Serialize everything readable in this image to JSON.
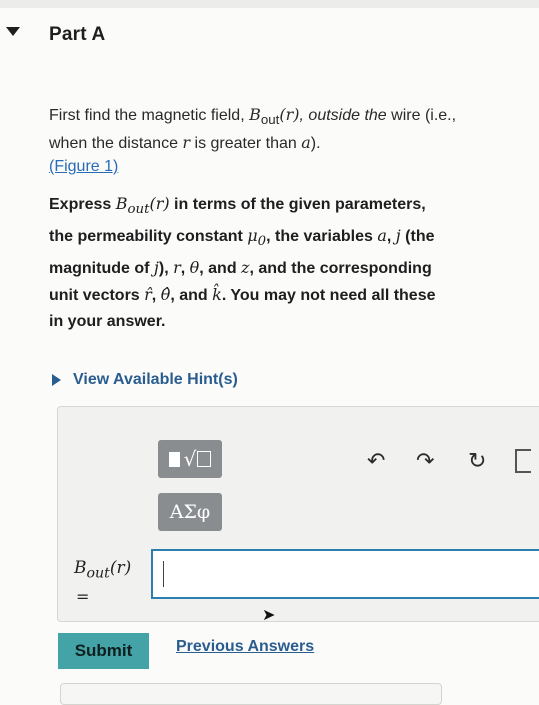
{
  "part": {
    "title": "Part A"
  },
  "instructions": {
    "p1_a": "First find the magnetic field, ",
    "p1_b": "B",
    "p1_c": "out",
    "p1_d": "(r)",
    "p1_e": ", outside the",
    "p1_f": "wire (i.e., when the distance ",
    "p1_g": "r",
    "p1_h": " is greater than ",
    "p1_i": "a",
    "p1_j": ").",
    "figure_link": "(Figure 1)",
    "p2_a": "Express ",
    "p2_b": "B",
    "p2_c": "out",
    "p2_d": "(r)",
    "p2_e": " in terms of the given parameters, the permeability constant ",
    "p2_f": "μ",
    "p2_g": "0",
    "p2_h": ", the variables ",
    "p2_i": "a",
    "p2_j": ", ",
    "p2_k": "j",
    "p2_l": " (the magnitude of ",
    "p2_m": "j",
    "p2_n": "), ",
    "p2_o": "r",
    "p2_p": ", ",
    "p2_q": "θ",
    "p2_r": ", and ",
    "p2_s": "z",
    "p2_t": ", and the corresponding unit vectors ",
    "p2_u": "r̂",
    "p2_v": ", ",
    "p2_w": "θ̂",
    "p2_x": ", and ",
    "p2_y": "k̂",
    "p2_z": ". You may not need all these in your answer."
  },
  "hints": {
    "label": "View Available Hint(s)"
  },
  "toolbar": {
    "greek_label": "ΑΣφ",
    "undo_icon": "↶",
    "redo_icon": "↷",
    "reset_icon": "↻",
    "keyboard_icon": "keyboard-icon"
  },
  "answer": {
    "label_b": "B",
    "label_sub": "out",
    "label_arg": "(r)",
    "label_eq": "=",
    "value": ""
  },
  "actions": {
    "submit_label": "Submit",
    "previous_answers_label": "Previous Answers"
  }
}
